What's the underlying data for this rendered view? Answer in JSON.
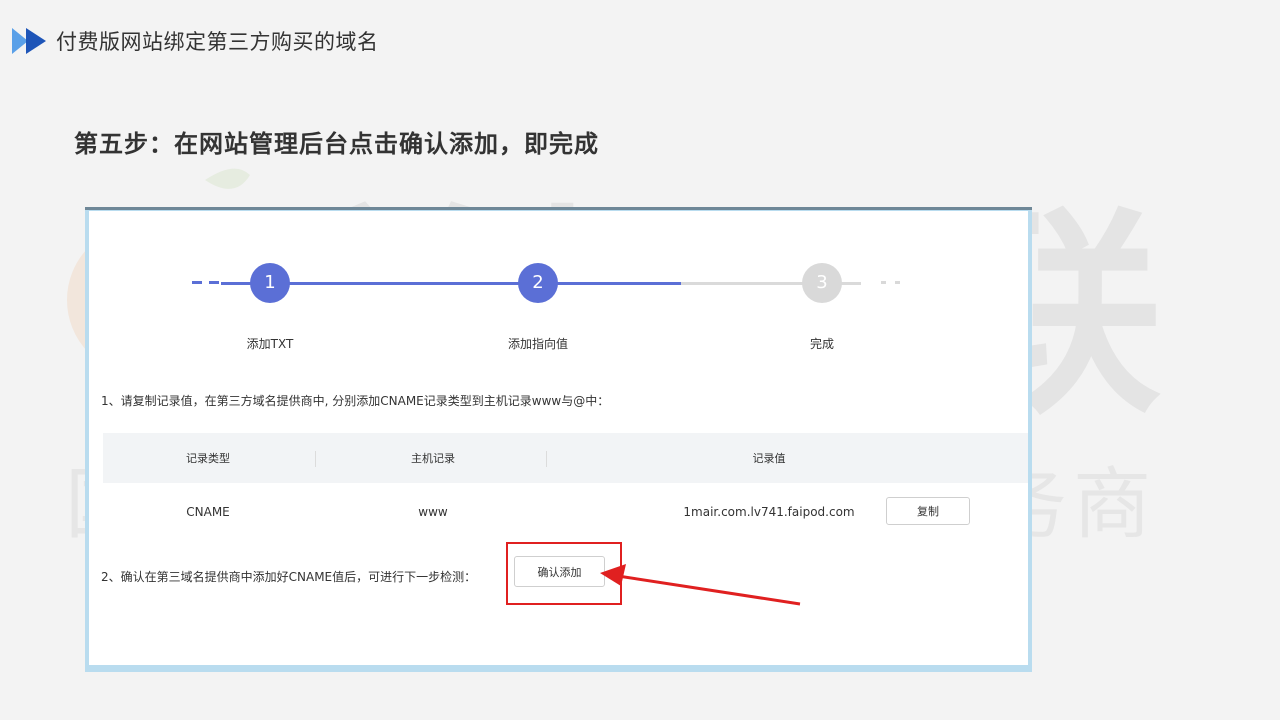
{
  "slide": {
    "title": "付费版网站绑定第三方购买的域名",
    "step_heading": "第五步：在网站管理后台点击确认添加，即完成"
  },
  "watermark": {
    "big_text": "美橘互联",
    "small_text": "国内领先的数字化营销服务商"
  },
  "stepper": {
    "steps": [
      {
        "number": "1",
        "label": "添加TXT",
        "state": "done"
      },
      {
        "number": "2",
        "label": "添加指向值",
        "state": "active"
      },
      {
        "number": "3",
        "label": "完成",
        "state": "pending"
      }
    ],
    "active_color": "#5b6fd6",
    "pending_color": "#d9d9d9"
  },
  "instructions": {
    "step1": "1、请复制记录值，在第三方域名提供商中, 分别添加CNAME记录类型到主机记录www与@中：",
    "step2": "2、确认在第三域名提供商中添加好CNAME值后，可进行下一步检测："
  },
  "record_table": {
    "headers": [
      "记录类型",
      "主机记录",
      "记录值"
    ],
    "rows": [
      {
        "type": "CNAME",
        "host": "www",
        "value": "1mair.com.lv741.faipod.com"
      }
    ],
    "copy_label": "复制"
  },
  "confirm_button": {
    "label": "确认添加"
  },
  "colors": {
    "highlight": "#e02020",
    "header_arrow": "#2f6fd6"
  }
}
